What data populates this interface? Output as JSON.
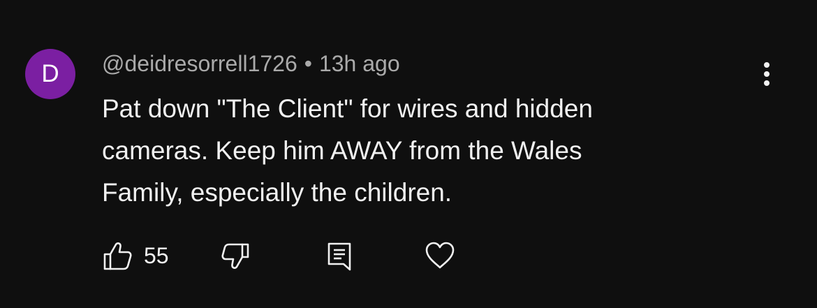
{
  "comment": {
    "avatar_letter": "D",
    "avatar_color": "#7b1fa2",
    "author": "@deidresorrell1726",
    "separator": "•",
    "timestamp": "13h ago",
    "text_lines": [
      "Pat down \"The Client\" for wires and hidden",
      "cameras.  Keep him AWAY from the Wales",
      "Family, especially the children."
    ],
    "like_count": "55"
  },
  "icons": {
    "more": "more-vert-icon",
    "like": "thumbs-up-icon",
    "dislike": "thumbs-down-icon",
    "reply": "reply-comment-icon",
    "heart": "heart-icon"
  }
}
